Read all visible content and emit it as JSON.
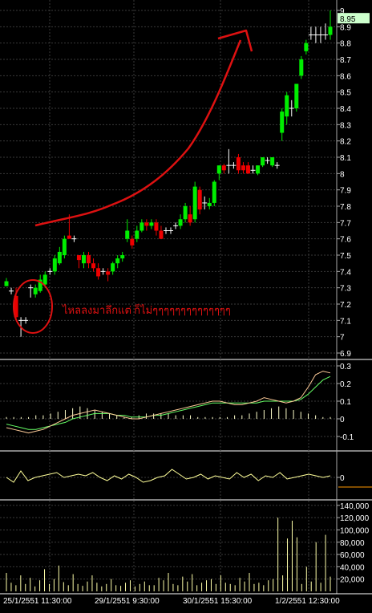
{
  "chart_data": [
    {
      "type": "candlestick",
      "panel": "price",
      "y_ticks": [
        "9",
        "8.9",
        "8.8",
        "8.7",
        "8.6",
        "8.5",
        "8.4",
        "8.3",
        "8.2",
        "8.1",
        "8",
        "7.9",
        "7.8",
        "7.7",
        "7.6",
        "7.5",
        "7.4",
        "7.3",
        "7.2",
        "7.1",
        "7",
        "6.9"
      ],
      "ylim": [
        6.85,
        9.05
      ],
      "last_price": "8.95",
      "annotation": "ไหลลงมาลึกแต่ ก็ไม่ๆๆๆๆๆๆๆๆๆๆๆๆๆๆ",
      "candles": [
        {
          "o": 7.34,
          "h": 7.36,
          "l": 7.31,
          "c": 7.31,
          "up": true
        },
        {
          "o": 7.28,
          "h": 7.3,
          "l": 7.26,
          "c": 7.28,
          "up": false
        },
        {
          "o": 7.25,
          "h": 7.3,
          "l": 7.1,
          "c": 7.12,
          "up": false
        },
        {
          "o": 7.1,
          "h": 7.12,
          "l": 7.0,
          "c": 7.1,
          "up": false
        },
        {
          "o": 7.1,
          "h": 7.12,
          "l": 7.08,
          "c": 7.1,
          "up": false
        },
        {
          "o": 7.3,
          "h": 7.32,
          "l": 7.24,
          "c": 7.3,
          "up": false
        },
        {
          "o": 7.26,
          "h": 7.32,
          "l": 7.24,
          "c": 7.3,
          "up": true
        },
        {
          "o": 7.28,
          "h": 7.38,
          "l": 7.27,
          "c": 7.35,
          "up": true
        },
        {
          "o": 7.32,
          "h": 7.4,
          "l": 7.3,
          "c": 7.38,
          "up": true
        },
        {
          "o": 7.4,
          "h": 7.42,
          "l": 7.38,
          "c": 7.4,
          "up": false
        },
        {
          "o": 7.4,
          "h": 7.5,
          "l": 7.38,
          "c": 7.48,
          "up": true
        },
        {
          "o": 7.45,
          "h": 7.55,
          "l": 7.44,
          "c": 7.52,
          "up": true
        },
        {
          "o": 7.5,
          "h": 7.62,
          "l": 7.48,
          "c": 7.6,
          "up": true
        },
        {
          "o": 7.6,
          "h": 7.75,
          "l": 7.6,
          "c": 7.62,
          "up": false
        },
        {
          "o": 7.6,
          "h": 7.62,
          "l": 7.58,
          "c": 7.6,
          "up": false
        },
        {
          "o": 7.5,
          "h": 7.5,
          "l": 7.42,
          "c": 7.47,
          "up": false
        },
        {
          "o": 7.45,
          "h": 7.52,
          "l": 7.42,
          "c": 7.5,
          "up": true
        },
        {
          "o": 7.5,
          "h": 7.52,
          "l": 7.42,
          "c": 7.45,
          "up": false
        },
        {
          "o": 7.45,
          "h": 7.48,
          "l": 7.4,
          "c": 7.42,
          "up": false
        },
        {
          "o": 7.42,
          "h": 7.45,
          "l": 7.35,
          "c": 7.37,
          "up": false
        },
        {
          "o": 7.4,
          "h": 7.42,
          "l": 7.38,
          "c": 7.4,
          "up": false
        },
        {
          "o": 7.38,
          "h": 7.42,
          "l": 7.34,
          "c": 7.4,
          "up": false
        },
        {
          "o": 7.4,
          "h": 7.46,
          "l": 7.38,
          "c": 7.45,
          "up": true
        },
        {
          "o": 7.45,
          "h": 7.5,
          "l": 7.42,
          "c": 7.48,
          "up": true
        },
        {
          "o": 7.48,
          "h": 7.52,
          "l": 7.46,
          "c": 7.5,
          "up": true
        },
        {
          "o": 7.6,
          "h": 7.72,
          "l": 7.58,
          "c": 7.65,
          "up": true
        },
        {
          "o": 7.6,
          "h": 7.62,
          "l": 7.54,
          "c": 7.56,
          "up": false
        },
        {
          "o": 7.6,
          "h": 7.68,
          "l": 7.58,
          "c": 7.65,
          "up": true
        },
        {
          "o": 7.65,
          "h": 7.72,
          "l": 7.64,
          "c": 7.7,
          "up": true
        },
        {
          "o": 7.7,
          "h": 7.72,
          "l": 7.65,
          "c": 7.68,
          "up": false
        },
        {
          "o": 7.68,
          "h": 7.72,
          "l": 7.66,
          "c": 7.7,
          "up": true
        },
        {
          "o": 7.7,
          "h": 7.72,
          "l": 7.62,
          "c": 7.65,
          "up": false
        },
        {
          "o": 7.65,
          "h": 7.68,
          "l": 7.6,
          "c": 7.6,
          "up": false
        },
        {
          "o": 7.65,
          "h": 7.67,
          "l": 7.63,
          "c": 7.65,
          "up": false
        },
        {
          "o": 7.65,
          "h": 7.67,
          "l": 7.63,
          "c": 7.65,
          "up": false
        },
        {
          "o": 7.68,
          "h": 7.7,
          "l": 7.66,
          "c": 7.68,
          "up": false
        },
        {
          "o": 7.68,
          "h": 7.75,
          "l": 7.66,
          "c": 7.72,
          "up": true
        },
        {
          "o": 7.72,
          "h": 7.82,
          "l": 7.7,
          "c": 7.8,
          "up": true
        },
        {
          "o": 7.75,
          "h": 7.8,
          "l": 7.68,
          "c": 7.7,
          "up": false
        },
        {
          "o": 7.72,
          "h": 7.95,
          "l": 7.7,
          "c": 7.92,
          "up": true
        },
        {
          "o": 7.9,
          "h": 7.92,
          "l": 7.75,
          "c": 7.78,
          "up": false
        },
        {
          "o": 7.82,
          "h": 7.86,
          "l": 7.78,
          "c": 7.82,
          "up": false
        },
        {
          "o": 7.8,
          "h": 7.85,
          "l": 7.78,
          "c": 7.82,
          "up": true
        },
        {
          "o": 7.82,
          "h": 7.96,
          "l": 7.8,
          "c": 7.95,
          "up": true
        },
        {
          "o": 8.0,
          "h": 8.05,
          "l": 7.96,
          "c": 8.05,
          "up": true
        },
        {
          "o": 8.05,
          "h": 8.06,
          "l": 8.0,
          "c": 8.02,
          "up": false
        },
        {
          "o": 8.05,
          "h": 8.15,
          "l": 8.0,
          "c": 8.05,
          "up": false
        },
        {
          "o": 8.05,
          "h": 8.07,
          "l": 8.03,
          "c": 8.05,
          "up": false
        },
        {
          "o": 8.1,
          "h": 8.12,
          "l": 8.0,
          "c": 8.02,
          "up": false
        },
        {
          "o": 8.05,
          "h": 8.07,
          "l": 8.0,
          "c": 8.02,
          "up": false
        },
        {
          "o": 8.05,
          "h": 8.07,
          "l": 8.0,
          "c": 8.0,
          "up": false
        },
        {
          "o": 8.02,
          "h": 8.05,
          "l": 8.0,
          "c": 8.02,
          "up": false
        },
        {
          "o": 8.0,
          "h": 8.05,
          "l": 7.99,
          "c": 8.05,
          "up": true
        },
        {
          "o": 8.05,
          "h": 8.1,
          "l": 8.04,
          "c": 8.1,
          "up": true
        },
        {
          "o": 8.08,
          "h": 8.1,
          "l": 8.06,
          "c": 8.08,
          "up": false
        },
        {
          "o": 8.05,
          "h": 8.1,
          "l": 8.04,
          "c": 8.1,
          "up": true
        },
        {
          "o": 8.05,
          "h": 8.07,
          "l": 8.03,
          "c": 8.05,
          "up": false
        },
        {
          "o": 8.25,
          "h": 8.4,
          "l": 8.2,
          "c": 8.38,
          "up": true
        },
        {
          "o": 8.35,
          "h": 8.5,
          "l": 8.3,
          "c": 8.48,
          "up": true
        },
        {
          "o": 8.4,
          "h": 8.45,
          "l": 8.35,
          "c": 8.4,
          "up": true
        },
        {
          "o": 8.4,
          "h": 8.55,
          "l": 8.38,
          "c": 8.55,
          "up": true
        },
        {
          "o": 8.6,
          "h": 8.72,
          "l": 8.58,
          "c": 8.7,
          "up": true
        },
        {
          "o": 8.75,
          "h": 8.82,
          "l": 8.73,
          "c": 8.8,
          "up": true
        },
        {
          "o": 8.85,
          "h": 8.9,
          "l": 8.82,
          "c": 8.85,
          "up": false
        },
        {
          "o": 8.85,
          "h": 8.9,
          "l": 8.8,
          "c": 8.85,
          "up": false
        },
        {
          "o": 8.85,
          "h": 8.9,
          "l": 8.8,
          "c": 8.85,
          "up": false
        },
        {
          "o": 8.85,
          "h": 8.92,
          "l": 8.82,
          "c": 8.85,
          "up": false
        },
        {
          "o": 8.85,
          "h": 9.0,
          "l": 8.82,
          "c": 8.9,
          "up": true
        }
      ]
    },
    {
      "type": "line",
      "panel": "macd",
      "y_ticks": [
        "0.3",
        "0.2",
        "0.1",
        "0",
        "-0.1"
      ],
      "ylim": [
        -0.16,
        0.32
      ],
      "macd": [
        -0.05,
        -0.06,
        -0.07,
        -0.08,
        -0.07,
        -0.06,
        -0.04,
        -0.02,
        0.0,
        0.02,
        0.03,
        0.04,
        0.05,
        0.04,
        0.03,
        0.02,
        0.01,
        0.0,
        0.0,
        0.01,
        0.02,
        0.03,
        0.04,
        0.05,
        0.06,
        0.07,
        0.08,
        0.09,
        0.1,
        0.1,
        0.09,
        0.08,
        0.08,
        0.09,
        0.1,
        0.12,
        0.11,
        0.1,
        0.09,
        0.1,
        0.12,
        0.18,
        0.25,
        0.27,
        0.26
      ],
      "signal": [
        -0.03,
        -0.04,
        -0.05,
        -0.06,
        -0.06,
        -0.05,
        -0.04,
        -0.03,
        -0.02,
        0.0,
        0.01,
        0.02,
        0.03,
        0.03,
        0.03,
        0.02,
        0.02,
        0.01,
        0.01,
        0.01,
        0.02,
        0.02,
        0.03,
        0.04,
        0.05,
        0.06,
        0.07,
        0.08,
        0.09,
        0.09,
        0.09,
        0.09,
        0.09,
        0.09,
        0.09,
        0.1,
        0.1,
        0.1,
        0.1,
        0.1,
        0.11,
        0.14,
        0.18,
        0.22,
        0.24
      ],
      "histogram": [
        0.01,
        0.01,
        0.01,
        0.01,
        0.02,
        0.02,
        0.03,
        0.04,
        0.05,
        0.06,
        0.07,
        0.06,
        0.05,
        0.04,
        0.03,
        0.02,
        0.01,
        0.01,
        0.02,
        0.03,
        0.03,
        0.03,
        0.03,
        0.02,
        0.02,
        0.02,
        0.01,
        0.01,
        0.01,
        0.01,
        0.01,
        0.02,
        0.02,
        0.03,
        0.04,
        0.05,
        0.06,
        0.07,
        0.06,
        0.05,
        0.04,
        0.03,
        0.02,
        0.01,
        0.01
      ]
    },
    {
      "type": "line",
      "panel": "oscillator",
      "y_ticks": [
        "0"
      ],
      "ylim": [
        -1,
        1
      ],
      "values": [
        0.0,
        -0.3,
        0.4,
        -0.2,
        0.0,
        0.1,
        0.2,
        0.3,
        0.0,
        0.1,
        0.2,
        0.1,
        0.3,
        0.0,
        -0.2,
        0.1,
        -0.1,
        0.2,
        0.0,
        -0.3,
        -0.2,
        0.0,
        0.1,
        0.5,
        0.2,
        -0.1,
        0.0,
        0.2,
        -0.1,
        0.1,
        0.0,
        -0.1,
        0.3,
        0.0,
        0.2,
        -0.2,
        0.1,
        0.0,
        0.3,
        -0.1,
        0.0,
        0.1,
        0.2,
        0.1,
        0.0,
        0.1
      ]
    },
    {
      "type": "bar",
      "panel": "volume",
      "y_ticks": [
        "140,000",
        "120,000",
        "100,000",
        "80,000",
        "60,000",
        "40,000",
        "20,000"
      ],
      "ylim": [
        0,
        150000
      ],
      "values": [
        30000,
        14000,
        10000,
        26000,
        12000,
        22000,
        8000,
        18000,
        36000,
        12000,
        20000,
        42000,
        15000,
        10000,
        28000,
        12000,
        9000,
        16000,
        26000,
        14000,
        8000,
        12000,
        20000,
        10000,
        9000,
        14000,
        18000,
        8000,
        12000,
        16000,
        10000,
        10000,
        22000,
        18000,
        30000,
        12000,
        10000,
        24000,
        16000,
        28000,
        10000,
        14000,
        18000,
        20000,
        12000,
        26000,
        14000,
        12000,
        10000,
        22000,
        16000,
        30000,
        12000,
        14000,
        10000,
        18000,
        20000,
        120000,
        26000,
        86000,
        115000,
        88000,
        12000,
        40000,
        16000,
        80000,
        14000,
        92000,
        24000
      ],
      "x_ticks": [
        "25/1/2551 11:30:00",
        "29/1/2551 9:30:00",
        "30/1/2551 15:30:00",
        "1/2/2551 12:30:00"
      ]
    }
  ],
  "colors": {
    "up": "#00ee00",
    "down": "#ee0000",
    "neutral": "#ffffff",
    "macd": "#ffcc99",
    "signal": "#66ff66",
    "histogram": "#ffffcc",
    "oscillator": "#ffff99",
    "volume": "#ffffaa",
    "annotation": "#dd1111",
    "grid": "#3a3a3a",
    "price_box": "#ccffcc"
  }
}
